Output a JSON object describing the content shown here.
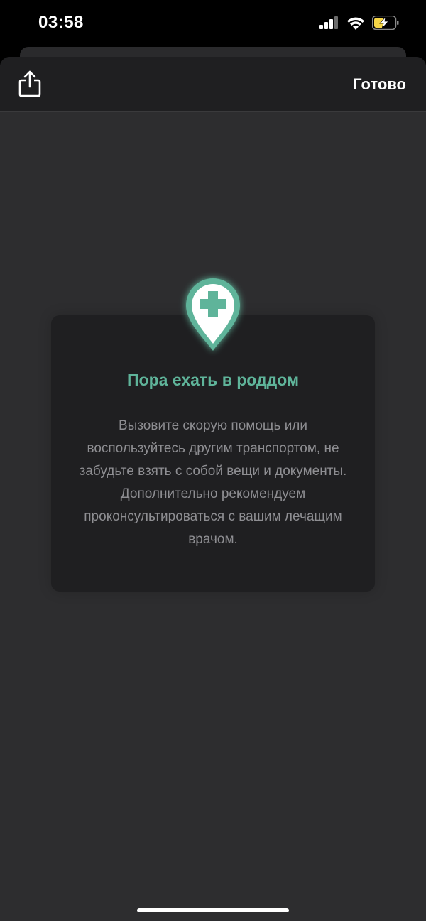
{
  "status_bar": {
    "time": "03:58",
    "icons": [
      "cellular-signal-icon",
      "wifi-icon",
      "battery-charging-icon"
    ]
  },
  "toolbar": {
    "share_icon": "share-icon",
    "done_label": "Готово"
  },
  "card": {
    "icon": "hospital-location-pin-icon",
    "title": "Пора ехать в роддом",
    "text": "Вызовите скорую помощь или воспользуйтесь другим транспортом, не забудьте взять с собой вещи и документы. Дополнительно рекомендуем проконсультироваться с вашим лечащим врачом."
  },
  "colors": {
    "accent": "#5fb49a",
    "battery": "#f5d547"
  }
}
